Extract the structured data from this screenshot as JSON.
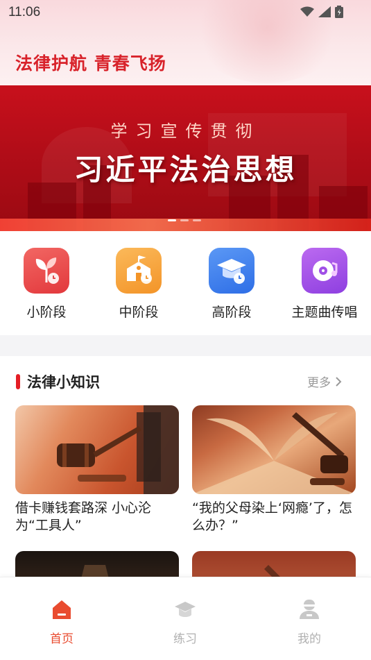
{
  "status_bar": {
    "time": "11:06"
  },
  "header": {
    "slogan": "法律护航 青春飞扬"
  },
  "banner": {
    "subtitle": "学习宣传贯彻",
    "title": "习近平法治思想",
    "page_count": 3,
    "active_index": 0
  },
  "categories": [
    {
      "label": "小阶段",
      "icon": "sprout-icon",
      "color": "#ee4a48"
    },
    {
      "label": "中阶段",
      "icon": "school-icon",
      "color": "#f7a23a"
    },
    {
      "label": "高阶段",
      "icon": "graduation-cap-icon",
      "color": "#3d7fee"
    },
    {
      "label": "主题曲传唱",
      "icon": "music-disc-icon",
      "color": "#a04fe6"
    }
  ],
  "knowledge": {
    "title": "法律小知识",
    "more_label": "更多",
    "articles": [
      {
        "title": "借卡赚钱套路深 小心沦为“工具人”"
      },
      {
        "title": "“我的父母染上‘网瘾’了，怎么办？”"
      },
      {
        "title": ""
      },
      {
        "title": ""
      }
    ]
  },
  "bottom_nav": {
    "items": [
      {
        "label": "首页",
        "active": true
      },
      {
        "label": "练习",
        "active": false
      },
      {
        "label": "我的",
        "active": false
      }
    ]
  },
  "colors": {
    "accent": "#e41e25",
    "nav_active": "#e94b2f",
    "nav_inactive": "#b0b0b0"
  }
}
